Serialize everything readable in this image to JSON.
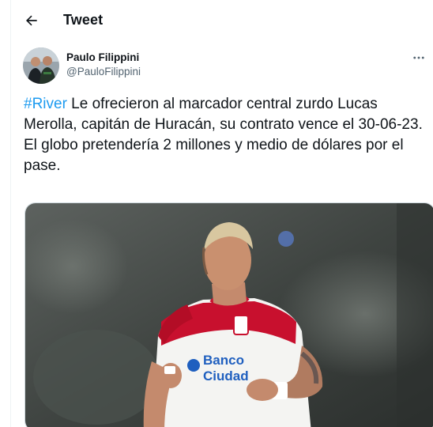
{
  "header": {
    "title": "Tweet"
  },
  "author": {
    "name": "Paulo Filippini",
    "handle": "@PauloFilippini"
  },
  "tweet": {
    "hashtag": "#River",
    "line1_rest": " Le ofrecieron al marcador central zurdo Lucas Merolla, capitán de Huracán, su contrato vence el 30-06-23.",
    "line2": "El globo pretendería 2 millones y medio de dólares por el pase."
  },
  "media": {
    "jersey_text": {
      "line1": "Banco",
      "line2": "Ciudad"
    }
  },
  "icons": {
    "back": "arrow-left-icon",
    "more": "more-horizontal-icon"
  },
  "colors": {
    "accent": "#1d9bf0",
    "secondary_text": "#536471",
    "primary_text": "#0f1419",
    "jersey_red": "#c8102e"
  }
}
